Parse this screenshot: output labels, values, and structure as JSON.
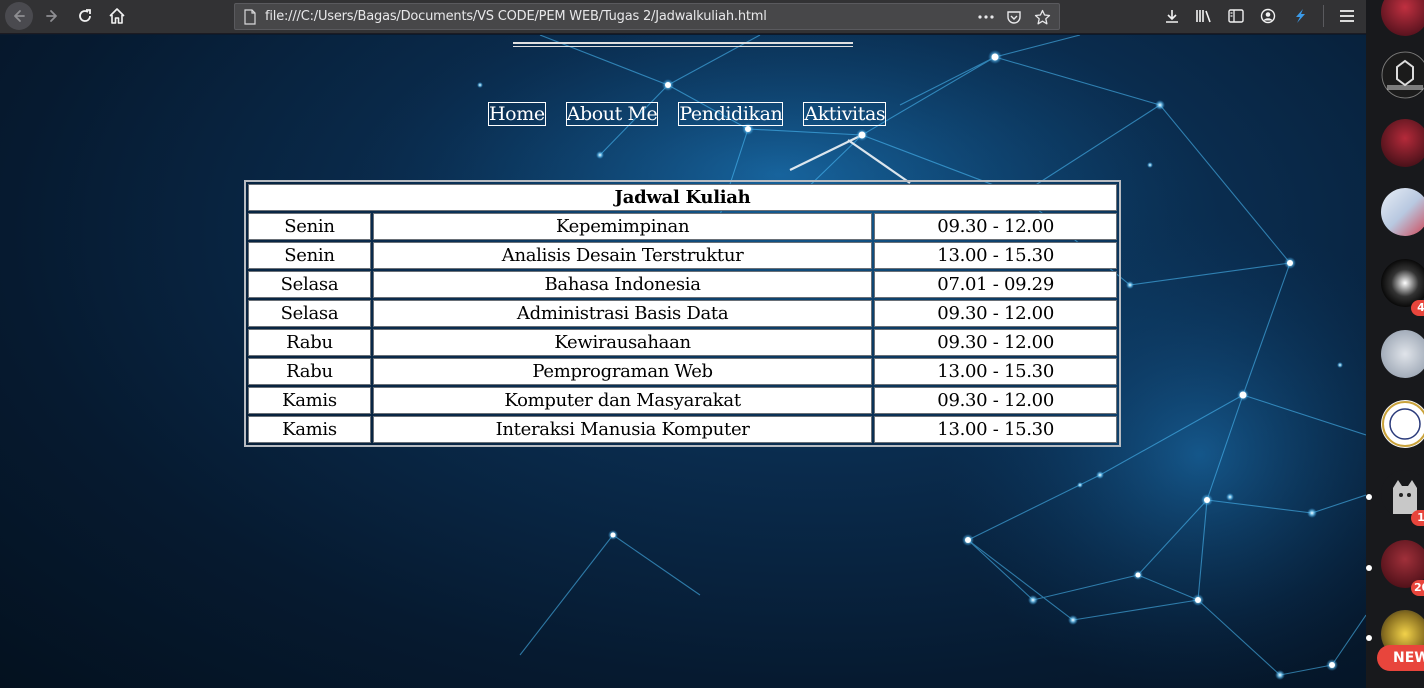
{
  "browser": {
    "url": "file:///C:/Users/Bagas/Documents/VS CODE/PEM WEB/Tugas 2/Jadwalkuliah.html",
    "icons": [
      "back-icon",
      "forward-icon",
      "reload-icon",
      "home-icon",
      "page-icon",
      "more-icon",
      "pocket-icon",
      "bookmark-star-icon",
      "download-icon",
      "library-icon",
      "sidebar-icon",
      "account-icon",
      "extension-icon",
      "menu-icon"
    ]
  },
  "nav": {
    "home": "Home",
    "about": "About Me",
    "education": "Pendidikan",
    "activities": "Aktivitas"
  },
  "schedule": {
    "title": "Jadwal Kuliah",
    "rows": [
      {
        "day": "Senin",
        "course": "Kepemimpinan",
        "time": "09.30 - 12.00"
      },
      {
        "day": "Senin",
        "course": "Analisis Desain Terstruktur",
        "time": "13.00 - 15.30"
      },
      {
        "day": "Selasa",
        "course": "Bahasa Indonesia",
        "time": "07.01 - 09.29"
      },
      {
        "day": "Selasa",
        "course": "Administrasi Basis Data",
        "time": "09.30 - 12.00"
      },
      {
        "day": "Rabu",
        "course": "Kewirausahaan",
        "time": "09.30 - 12.00"
      },
      {
        "day": "Rabu",
        "course": "Pemprograman Web",
        "time": "13.00 - 15.30"
      },
      {
        "day": "Kamis",
        "course": "Komputer dan Masyarakat",
        "time": "09.30 - 12.00"
      },
      {
        "day": "Kamis",
        "course": "Interaksi Manusia Komputer",
        "time": "13.00 - 15.30"
      }
    ]
  },
  "sidebar": {
    "badges": [
      "4",
      "1",
      "20"
    ],
    "new_label": "NEW"
  },
  "colors": {
    "toolbar": "#323234",
    "urlbar": "#474749",
    "page_bg": "#0a2c4e",
    "badge": "#e8453c"
  }
}
